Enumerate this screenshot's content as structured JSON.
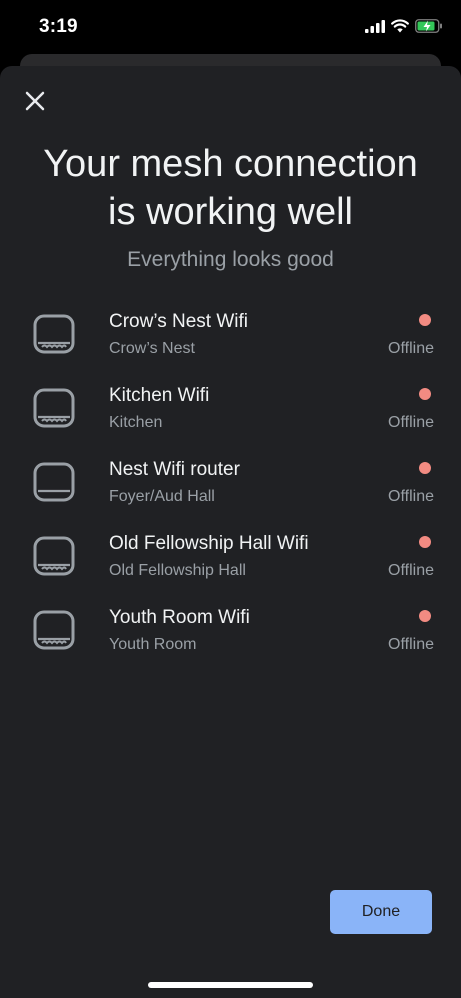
{
  "status_bar": {
    "time": "3:19"
  },
  "sheet": {
    "headline_line1": "Your mesh connection",
    "headline_line2": "is working well",
    "subhead": "Everything looks good"
  },
  "devices": [
    {
      "name": "Crow’s Nest Wifi",
      "room": "Crow’s Nest",
      "status": "Offline",
      "icon": "wifi-point-icon"
    },
    {
      "name": "Kitchen Wifi",
      "room": "Kitchen",
      "status": "Offline",
      "icon": "wifi-point-icon"
    },
    {
      "name": "Nest Wifi router",
      "room": "Foyer/Aud Hall",
      "status": "Offline",
      "icon": "wifi-router-icon"
    },
    {
      "name": "Old Fellowship Hall Wifi",
      "room": "Old Fellowship Hall",
      "status": "Offline",
      "icon": "wifi-point-icon"
    },
    {
      "name": "Youth Room Wifi",
      "room": "Youth Room",
      "status": "Offline",
      "icon": "wifi-point-icon"
    }
  ],
  "actions": {
    "done_label": "Done"
  },
  "colors": {
    "offline_dot": "#f28b82",
    "done_button": "#8ab4f8",
    "sheet_background": "#202124"
  }
}
